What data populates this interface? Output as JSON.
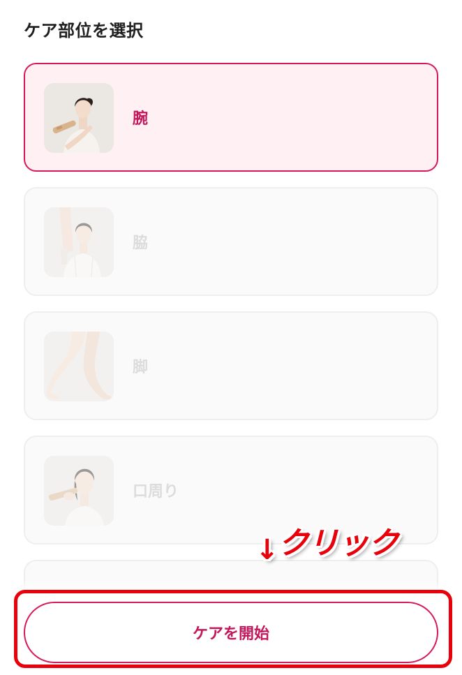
{
  "header": {
    "title": "ケア部位を選択"
  },
  "options": [
    {
      "label": "腕",
      "selected": true,
      "icon": "arm-care-photo"
    },
    {
      "label": "脇",
      "selected": false,
      "icon": "underarm-care-photo"
    },
    {
      "label": "脚",
      "selected": false,
      "icon": "legs-care-photo"
    },
    {
      "label": "口周り",
      "selected": false,
      "icon": "mouth-area-care-photo"
    }
  ],
  "start_button": {
    "label": "ケアを開始"
  },
  "annotation": {
    "arrow": "↓",
    "text": "クリック"
  },
  "colors": {
    "accent": "#d7195c",
    "selected_bg": "#fff0f4",
    "annotation_red": "#e8000b"
  }
}
